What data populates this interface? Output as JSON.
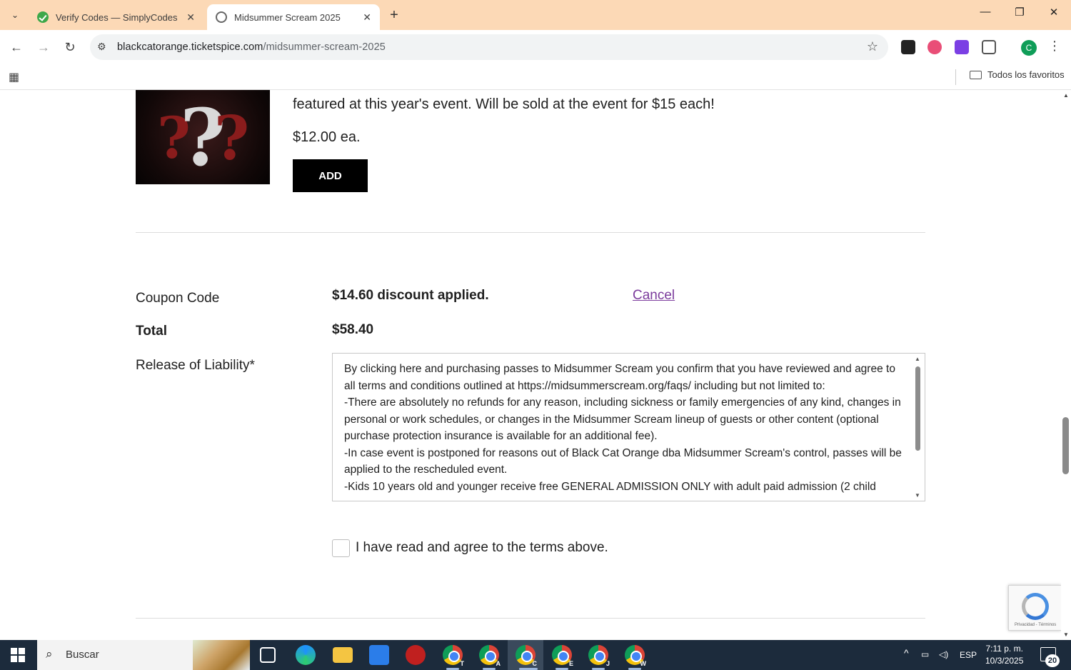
{
  "browser": {
    "tabs": [
      {
        "title": "Verify Codes — SimplyCodes",
        "active": false
      },
      {
        "title": "Midsummer Scream 2025",
        "active": true
      }
    ],
    "url_host": "blackcatorange.ticketspice.com",
    "url_path": "/midsummer-scream-2025",
    "bookmarks_folder": "Todos los favoritos",
    "profile_initial": "C"
  },
  "product": {
    "description_line": "featured at this year's event. Will be sold at the event for $15 each!",
    "price": "$12.00 ea.",
    "add_label": "ADD"
  },
  "coupon": {
    "label": "Coupon Code",
    "discount_text": "$14.60 discount applied.",
    "cancel_label": "Cancel"
  },
  "total": {
    "label": "Total",
    "value": "$58.40"
  },
  "liability": {
    "label": "Release of Liability*",
    "terms": [
      "By clicking here and purchasing passes to Midsummer Scream you confirm that you have reviewed and agree to all terms and conditions outlined at https://midsummerscream.org/faqs/ including but not limited to:",
      "-There are absolutely no refunds for any reason, including sickness or family emergencies of any kind, changes in personal or work schedules, or changes in the Midsummer Scream lineup of guests or other content (optional purchase protection insurance is available for an additional fee).",
      "-In case event is postponed for reasons out of Black Cat Orange dba Midsummer Scream's control, passes will be applied to the rescheduled event.",
      "-Kids 10 years old and younger receive free GENERAL ADMISSION ONLY with adult paid admission (2 child"
    ],
    "agree_text": "I have read and agree to the terms above."
  },
  "recaptcha": {
    "small_text": "Privacidad - Términos"
  },
  "taskbar": {
    "search_text": "Buscar",
    "language": "ESP",
    "time": "7:11 p. m.",
    "date": "10/3/2025",
    "notifications": "20",
    "chrome_profiles": [
      "T",
      "A",
      "C",
      "E",
      "J",
      "W"
    ]
  },
  "colors": {
    "tabbar_bg": "#fcd9b6",
    "link": "#7b3b9c",
    "button_bg": "#000000",
    "taskbar_bg": "#1c2b3c"
  }
}
